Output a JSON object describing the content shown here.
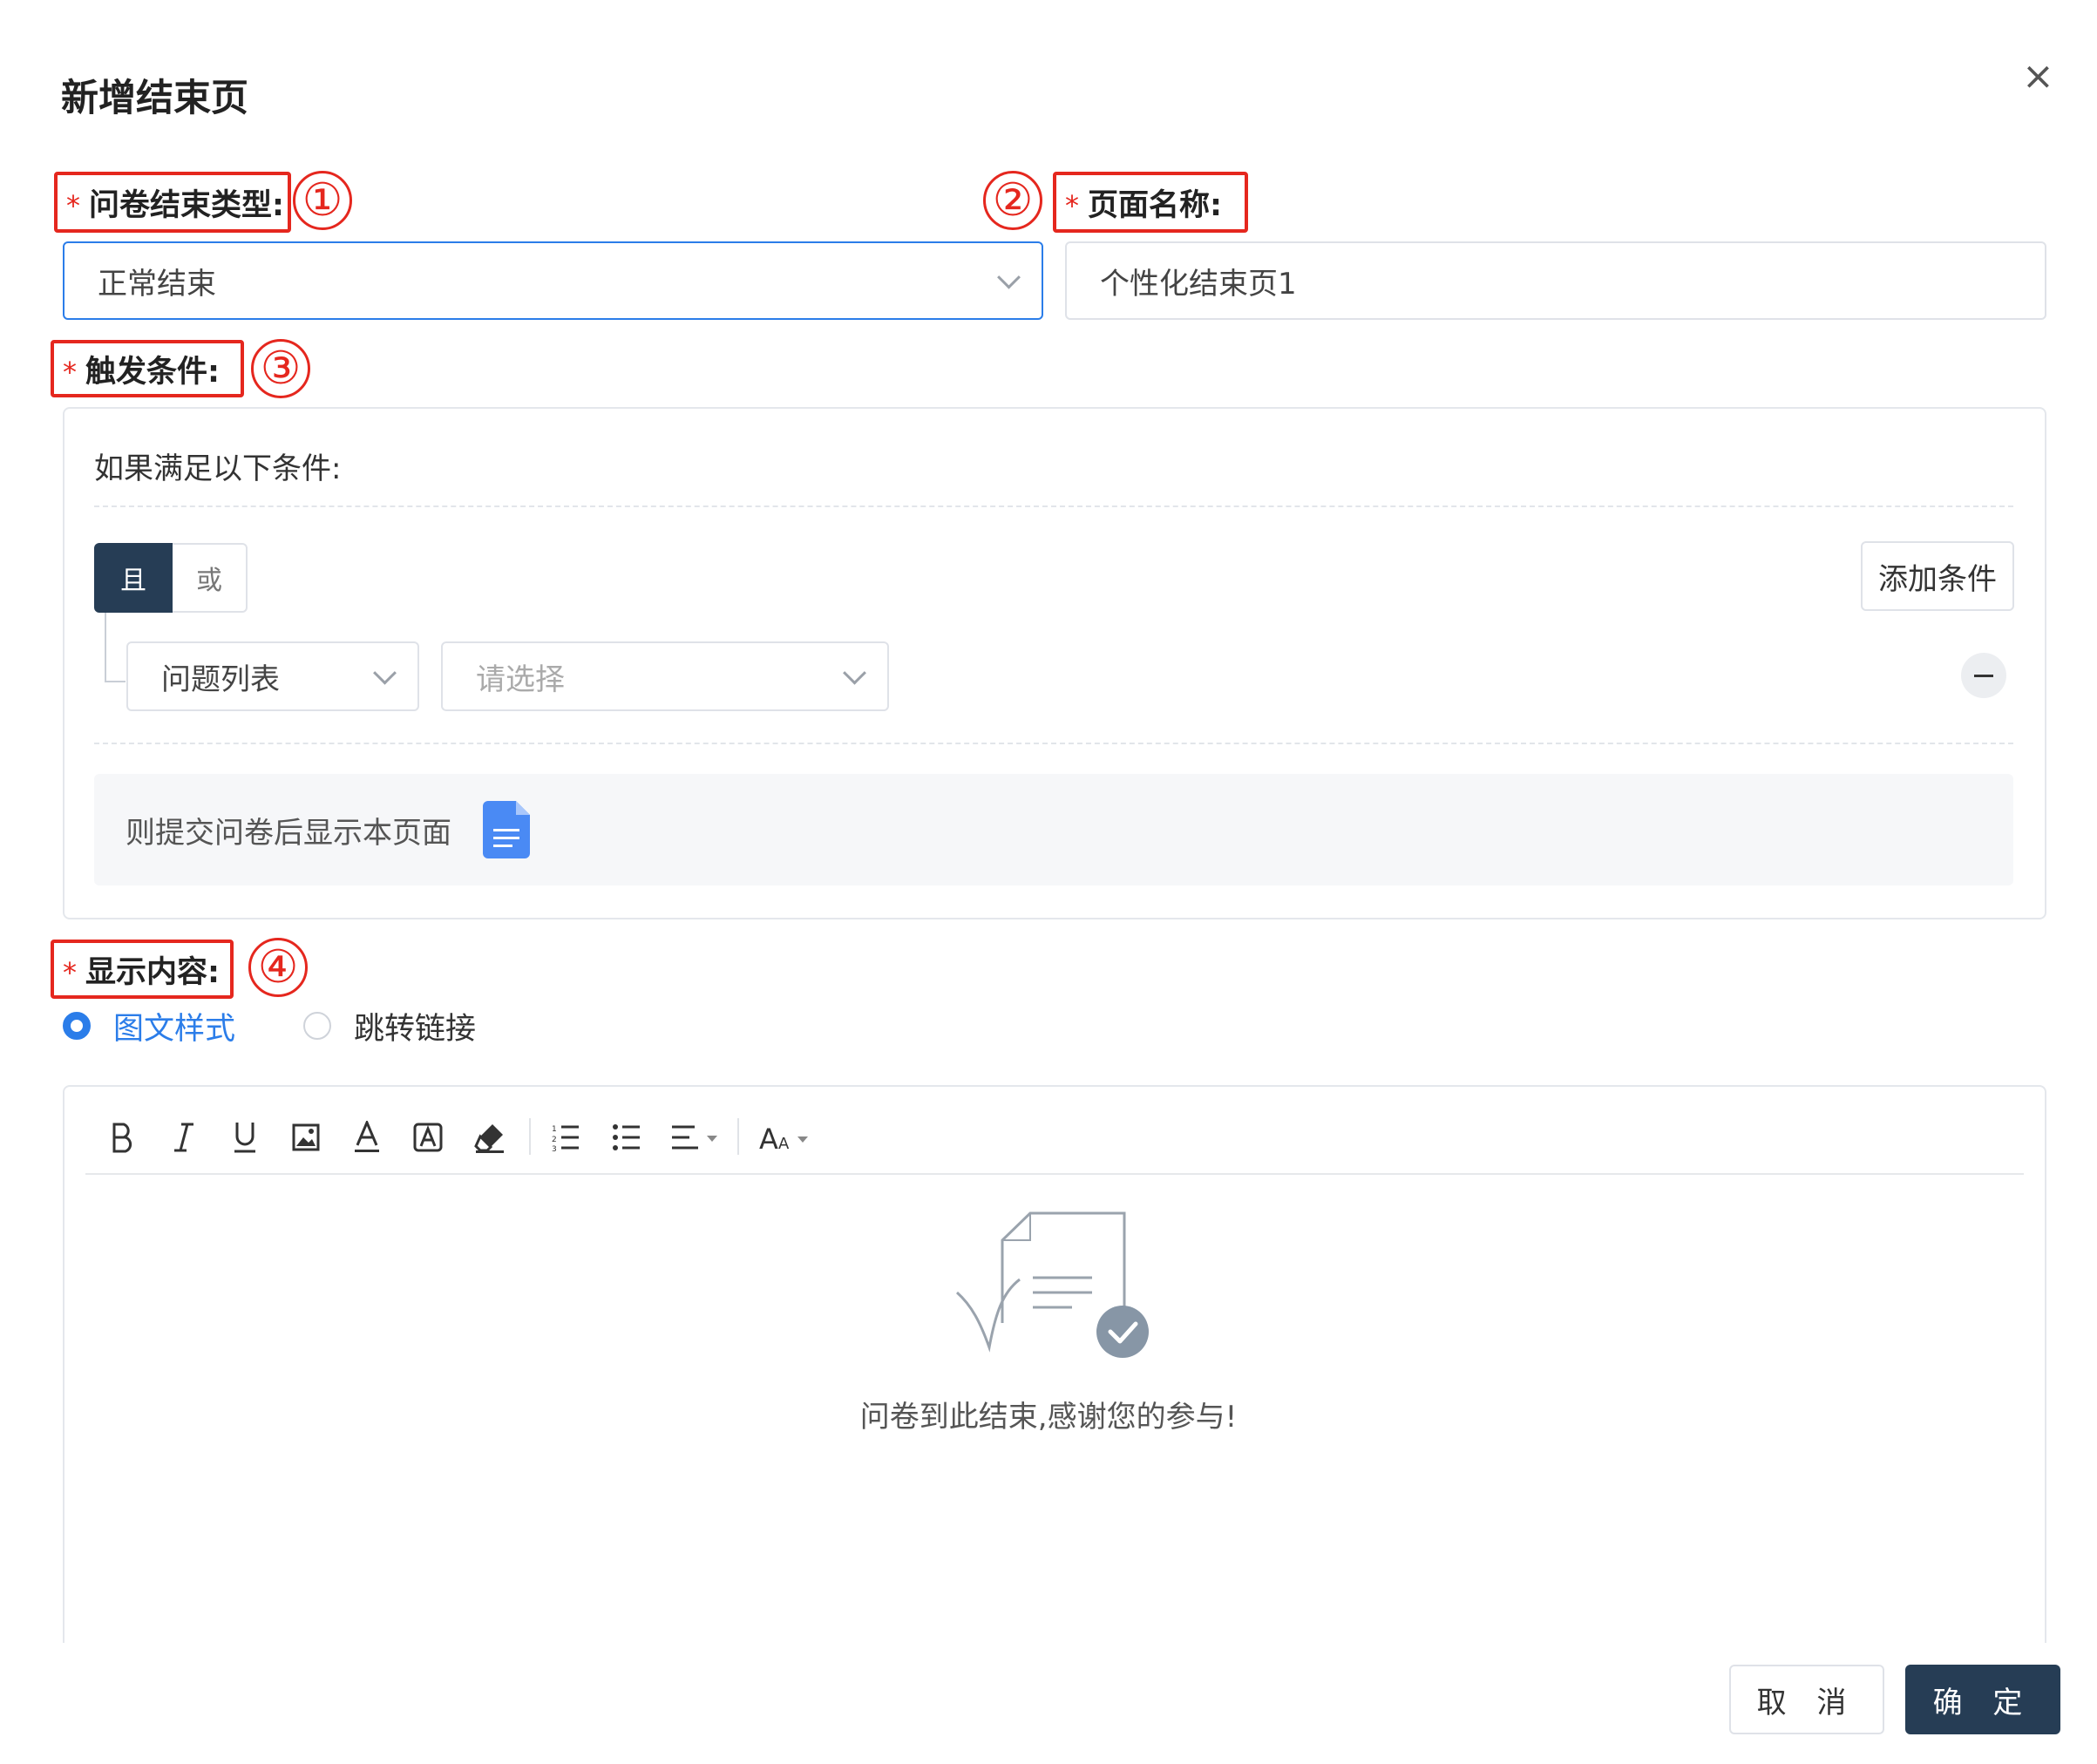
{
  "dialog": {
    "title": "新增结束页",
    "close_symbol": "×"
  },
  "fields": {
    "end_type": {
      "label": "问卷结束类型:",
      "required": "*",
      "marker": "①",
      "value": "正常结束"
    },
    "page_name": {
      "label": "页面名称:",
      "required": "*",
      "marker": "②",
      "value": "个性化结束页1"
    },
    "trigger": {
      "label": "触发条件:",
      "required": "*",
      "marker": "③"
    },
    "display": {
      "label": "显示内容:",
      "required": "*",
      "marker": "④"
    }
  },
  "condition": {
    "intro": "如果满足以下条件:",
    "logic_and": "且",
    "logic_or": "或",
    "add_button": "添加条件",
    "question_select": "问题列表",
    "option_select_placeholder": "请选择",
    "result_text": "则提交问卷后显示本页面"
  },
  "display_options": {
    "rich": "图文样式",
    "link": "跳转链接",
    "selected": "rich"
  },
  "editor": {
    "toolbar": [
      "bold-icon",
      "italic-icon",
      "underline-icon",
      "image-icon",
      "font-color-icon",
      "background-color-icon",
      "eraser-icon",
      "ordered-list-icon",
      "unordered-list-icon",
      "align-icon",
      "font-size-icon"
    ],
    "content_text": "问卷到此结束,感谢您的参与!"
  },
  "footer": {
    "cancel": "取 消",
    "confirm": "确 定"
  },
  "colors": {
    "primary": "#263d55",
    "accent": "#2b7de9",
    "annotation": "#e5271e"
  }
}
